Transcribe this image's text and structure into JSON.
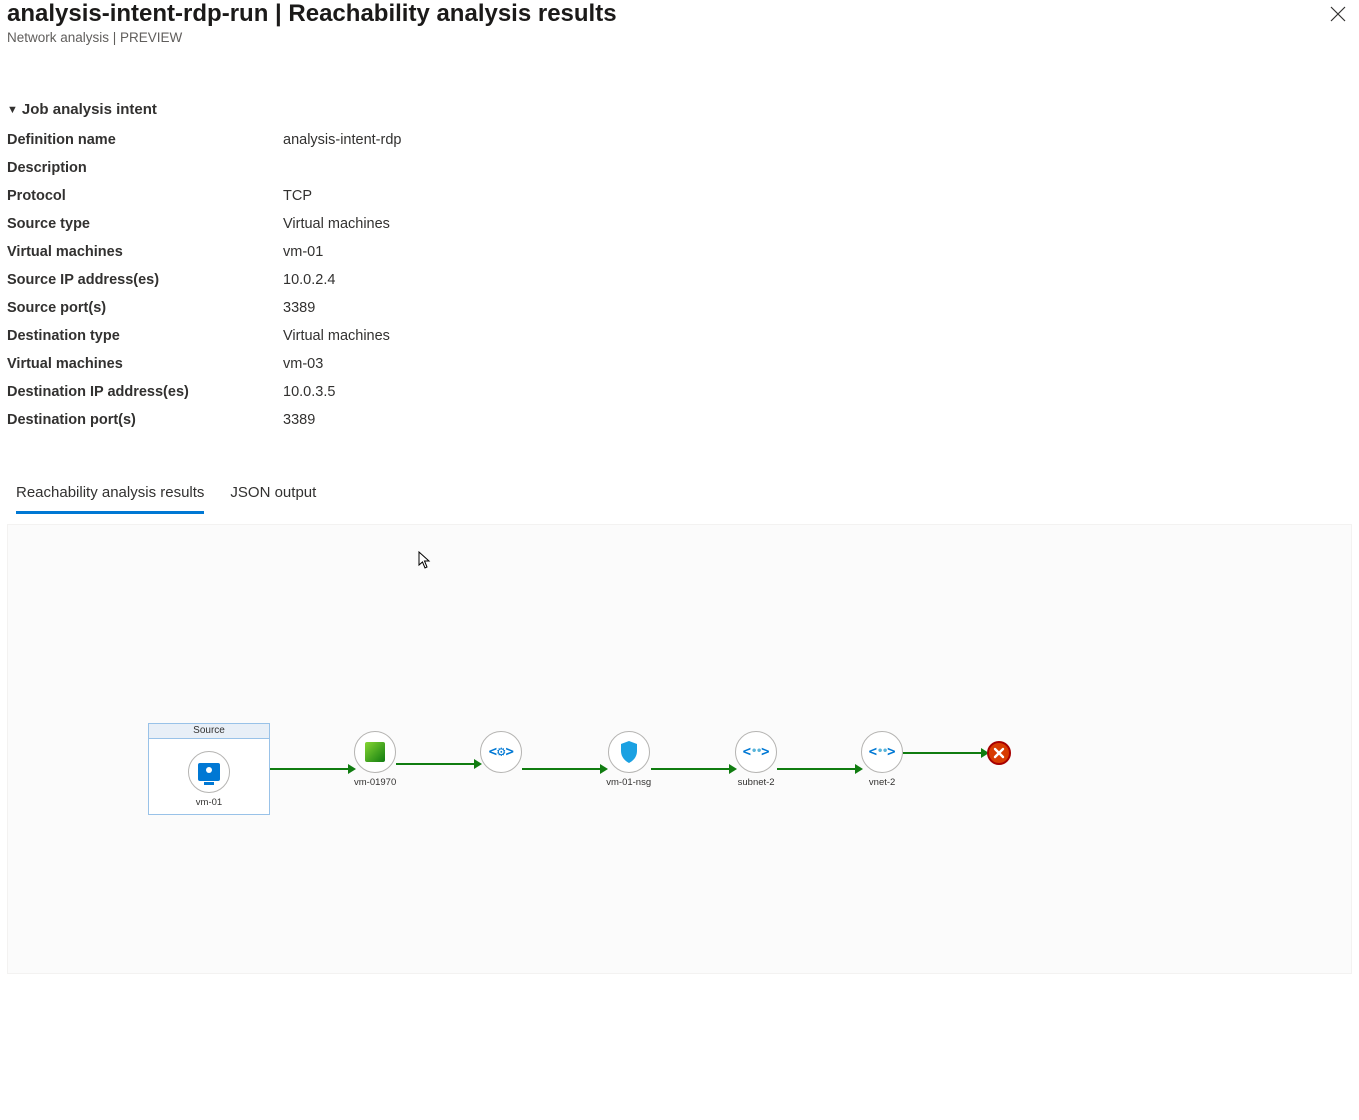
{
  "header": {
    "title": "analysis-intent-rdp-run | Reachability analysis results",
    "subtitle": "Network analysis | PREVIEW"
  },
  "intentSection": {
    "heading": "Job analysis intent",
    "fields": {
      "definition_name_label": "Definition name",
      "definition_name_value": "analysis-intent-rdp",
      "description_label": "Description",
      "description_value": "",
      "protocol_label": "Protocol",
      "protocol_value": "TCP",
      "source_type_label": "Source type",
      "source_type_value": "Virtual machines",
      "source_vm_label": "Virtual machines",
      "source_vm_value": "vm-01",
      "source_ip_label": "Source IP address(es)",
      "source_ip_value": "10.0.2.4",
      "source_port_label": "Source port(s)",
      "source_port_value": "3389",
      "dest_type_label": "Destination type",
      "dest_type_value": "Virtual machines",
      "dest_vm_label": "Virtual machines",
      "dest_vm_value": "vm-03",
      "dest_ip_label": "Destination IP address(es)",
      "dest_ip_value": "10.0.3.5",
      "dest_port_label": "Destination port(s)",
      "dest_port_value": "3389"
    }
  },
  "tabs": {
    "results_label": "Reachability analysis results",
    "json_label": "JSON output"
  },
  "diagram": {
    "source_group_label": "Source",
    "nodes": {
      "n0": "vm-01",
      "n1": "vm-01970",
      "n2": "",
      "n3": "vm-01-nsg",
      "n4": "subnet-2",
      "n5": "vnet-2"
    }
  }
}
